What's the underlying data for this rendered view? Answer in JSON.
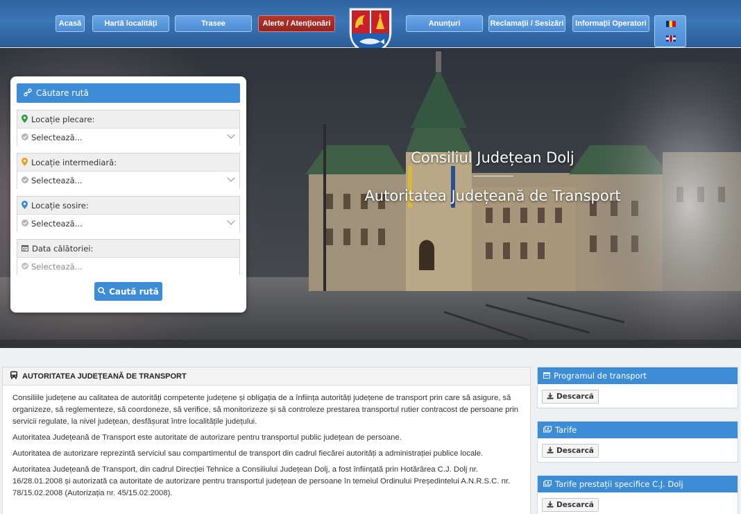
{
  "nav": {
    "items": [
      {
        "label": "Acasă",
        "name": "nav-acasa",
        "alert": false
      },
      {
        "label": "Hartă localități",
        "name": "nav-harta-localitati",
        "alert": false
      },
      {
        "label": "Trasee",
        "name": "nav-trasee",
        "alert": false
      },
      {
        "label": "Alerte / Atenționări",
        "name": "nav-alerte",
        "alert": true
      },
      {
        "label": "Anunțuri",
        "name": "nav-anunturi",
        "alert": false
      },
      {
        "label": "Reclamații / Sesizări",
        "name": "nav-reclamatii",
        "alert": false
      },
      {
        "label": "Informații Operatori",
        "name": "nav-informatii-operatori",
        "alert": false
      }
    ]
  },
  "hero": {
    "line1": "Consiliul Județean Dolj",
    "line2": "Autoritatea Județeană de Transport"
  },
  "search": {
    "header": "Căutare rută",
    "fields": [
      {
        "label": "Locație plecare:",
        "value": "Selectează...",
        "icon_color": "#2e9e3e"
      },
      {
        "label": "Locație intermediară:",
        "value": "Selectează...",
        "icon_color": "#e8a320"
      },
      {
        "label": "Locație sosire:",
        "value": "Selectează...",
        "icon_color": "#3c8dd6"
      },
      {
        "label": "Data călătoriei:",
        "value": "Selectează..."
      }
    ],
    "button": "Caută rută"
  },
  "main": {
    "title": "AUTORITATEA JUDEȚEANĂ DE TRANSPORT",
    "paragraphs": [
      "Consiliile județene au calitatea de autorități competente județene și obligația de a înființa autorități județene de transport prin care să asigure, să organizeze, să reglementeze, să coordoneze, să verifice, să monitorizeze și să controleze prestarea transportul rutier contracost de persoane prin servicii regulate, la nivel județean, desfășurat între localitățile județului.",
      "Autoritatea Județeană de Transport este autoritate de autorizare pentru transportul public județean de persoane.",
      "Autoritatea de autorizare reprezintă serviciul sau compartimentul de transport din cadrul fiecărei autorități a administrației publice locale.",
      "Autoritatea Județeană de Transport, din cadrul Direcției Tehnice a Consiliului Județean Dolj, a fost înființată prin Hotărârea C.J. Dolj nr. 16/28.01.2008 și autorizată ca autoritate de autorizare pentru transportul județean de persoane în temeiul Ordinului Președintelui A.N.R.S.C. nr. 78/15.02.2008 (Autorizația nr. 45/15.02.2008)."
    ]
  },
  "side": [
    {
      "title": "Programul de transport",
      "button": "Descarcă"
    },
    {
      "title": "Tarife",
      "button": "Descarcă"
    },
    {
      "title": "Tarife prestații specifice C.J. Dolj",
      "button": "Descarcă"
    }
  ],
  "colors": {
    "primary": "#3c8dd6",
    "alert": "#a52d27",
    "nav_bg": "#3a76b8"
  }
}
